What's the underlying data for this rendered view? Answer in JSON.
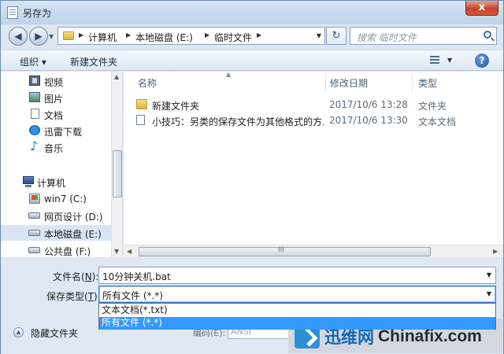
{
  "window": {
    "title": "另存为",
    "close": "x"
  },
  "address": {
    "parts": [
      "计算机",
      "本地磁盘 (E:)",
      "临时文件"
    ],
    "search_placeholder": "搜索 临时文件"
  },
  "toolbar": {
    "organize": "组织 ▾",
    "new_folder": "新建文件夹"
  },
  "nav": {
    "items": [
      {
        "label": "视频",
        "icon": "video-icon"
      },
      {
        "label": "图片",
        "icon": "picture-icon"
      },
      {
        "label": "文档",
        "icon": "document-icon"
      },
      {
        "label": "迅雷下载",
        "icon": "thunder-download-icon"
      },
      {
        "label": "音乐",
        "icon": "music-icon"
      },
      {
        "label": "计算机",
        "icon": "computer-icon"
      },
      {
        "label": "win7 (C:)",
        "icon": "drive-icon"
      },
      {
        "label": "网页设计 (D:)",
        "icon": "drive-icon"
      },
      {
        "label": "本地磁盘 (E:)",
        "icon": "drive-icon",
        "selected": true
      },
      {
        "label": "公共盘 (F:)",
        "icon": "drive-icon"
      }
    ]
  },
  "file_list": {
    "columns": [
      "名称",
      "修改日期",
      "类型"
    ],
    "rows": [
      {
        "name": "新建文件夹",
        "date": "2017/10/6 13:28",
        "type": "文件夹",
        "icon": "folder-icon"
      },
      {
        "name": "小技巧：另类的保存文件为其他格式的方...",
        "date": "2017/10/6 13:30",
        "type": "文本文档",
        "icon": "text-file-icon"
      }
    ],
    "hscroll_grip": "III"
  },
  "save": {
    "filename_label": "文件名(",
    "filename_key": "N",
    "filename_label_end": "):",
    "filename_value": "10分钟关机.bat",
    "type_label": "保存类型(",
    "type_key": "T",
    "type_label_end": "):",
    "type_value": "所有文件  (*.*)",
    "options": [
      "文本文档(*.txt)",
      "所有文件  (*.*)"
    ],
    "selected_option": 1
  },
  "hide_folders": "隐藏文件夹",
  "encoding": {
    "label": "编码(E):",
    "value": "ANSI"
  },
  "watermark": {
    "cn": "迅维网",
    "en": "Chinafix.com"
  }
}
